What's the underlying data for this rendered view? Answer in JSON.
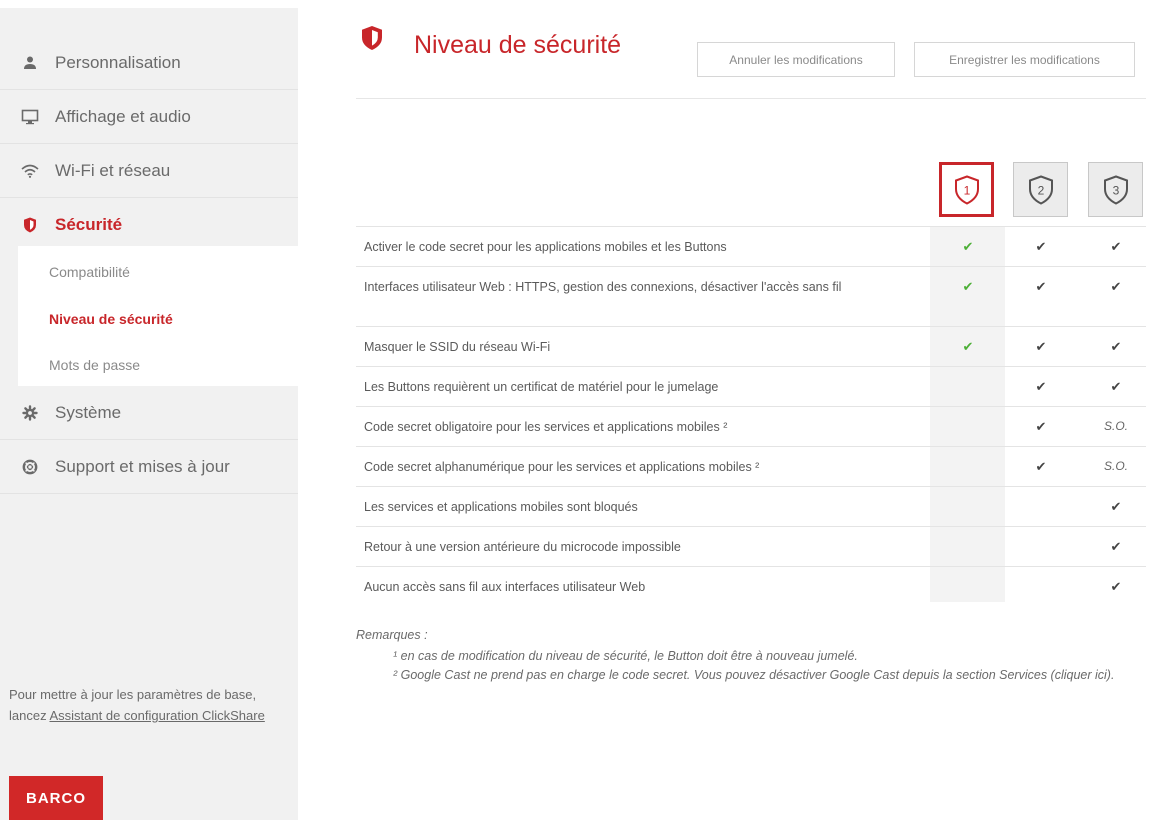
{
  "sidebar": {
    "items": [
      {
        "label": "Personnalisation",
        "icon": "user-icon"
      },
      {
        "label": "Affichage et audio",
        "icon": "monitor-icon"
      },
      {
        "label": "Wi-Fi et réseau",
        "icon": "wifi-icon"
      },
      {
        "label": "Sécurité",
        "icon": "shield-icon",
        "active": true
      },
      {
        "label": "Système",
        "icon": "gear-icon"
      },
      {
        "label": "Support et mises à jour",
        "icon": "lifebuoy-icon"
      }
    ],
    "subitems": [
      {
        "label": "Compatibilité"
      },
      {
        "label": "Niveau de sécurité",
        "active": true
      },
      {
        "label": "Mots de passe"
      }
    ],
    "help_text": "Pour mettre à jour les paramètres de base, lancez",
    "help_link": "Assistant de configuration ClickShare",
    "logo_text": "BARCO"
  },
  "header": {
    "title": "Niveau de sécurité",
    "cancel_label": "Annuler les modifications",
    "save_label": "Enregistrer les modifications"
  },
  "levels": {
    "items": [
      {
        "label": "1",
        "selected": true
      },
      {
        "label": "2",
        "selected": false
      },
      {
        "label": "3",
        "selected": false
      }
    ]
  },
  "table": {
    "rows": [
      {
        "text": "Activer le code secret pour les applications mobiles et les Buttons",
        "l1": "check",
        "l2": "check",
        "l3": "check"
      },
      {
        "text": "Interfaces utilisateur Web : HTTPS, gestion des connexions, désactiver l'accès sans fil",
        "l1": "check",
        "l2": "check",
        "l3": "check"
      },
      {
        "text": "Masquer le SSID du réseau Wi-Fi",
        "l1": "check",
        "l2": "check",
        "l3": "check"
      },
      {
        "text": "Les Buttons requièrent un certificat de matériel pour le jumelage",
        "l1": "",
        "l2": "check",
        "l3": "check"
      },
      {
        "text": "Code secret obligatoire pour les services et applications mobiles ²",
        "l1": "",
        "l2": "check",
        "l3": "S.O."
      },
      {
        "text": "Code secret alphanumérique pour les services et applications mobiles ²",
        "l1": "",
        "l2": "check",
        "l3": "S.O."
      },
      {
        "text": "Les services et applications mobiles sont bloqués",
        "l1": "",
        "l2": "",
        "l3": "check"
      },
      {
        "text": "Retour à une version antérieure du microcode impossible",
        "l1": "",
        "l2": "",
        "l3": "check"
      },
      {
        "text": "Aucun accès sans fil aux interfaces utilisateur Web",
        "l1": "",
        "l2": "",
        "l3": "check"
      }
    ]
  },
  "notes": {
    "title": "Remarques :",
    "note1": "¹ en cas de modification du niveau de sécurité, le Button doit être à nouveau jumelé.",
    "note2": "² Google Cast ne prend pas en charge le code secret. Vous pouvez désactiver Google Cast depuis la section Services (cliquer ici)."
  },
  "colors": {
    "accent": "#c8262a",
    "check_selected": "#4caf36",
    "check_default": "#444444"
  }
}
